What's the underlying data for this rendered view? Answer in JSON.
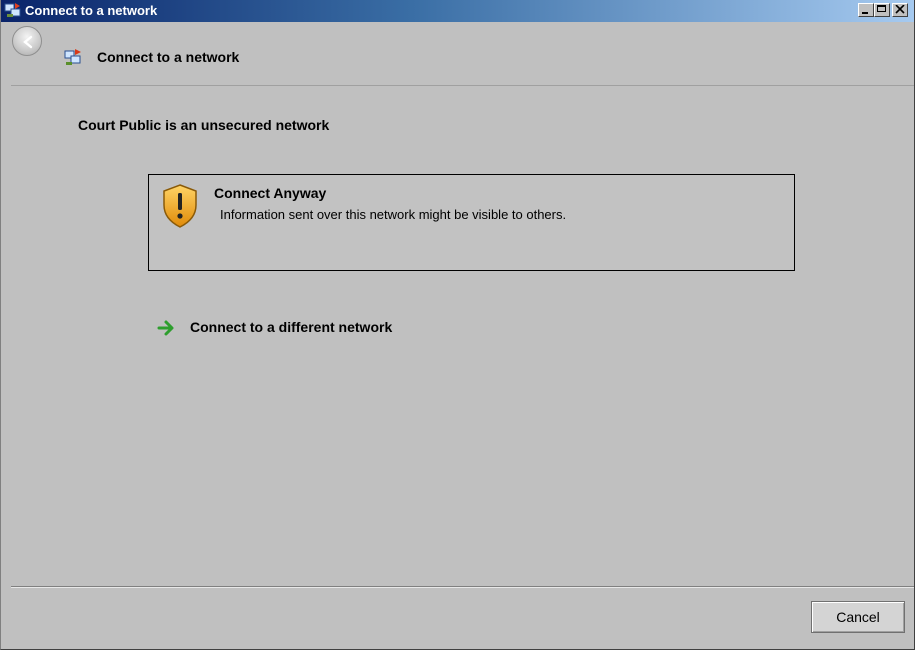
{
  "window": {
    "title": "Connect to a network",
    "icon": "network-connect-icon",
    "controls": {
      "minimize": "minimize-icon",
      "maximize": "maximize-icon",
      "close": "close-icon"
    }
  },
  "nav": {
    "back_icon": "back-arrow-icon",
    "title": "Connect to a network"
  },
  "main": {
    "heading": "Court Public is an unsecured network",
    "connect_anyway": {
      "icon": "warning-shield-icon",
      "title": "Connect Anyway",
      "description": "Information sent over this network might be visible to others."
    },
    "alternative": {
      "icon": "green-arrow-icon",
      "label": "Connect to a different network"
    }
  },
  "footer": {
    "cancel_label": "Cancel"
  },
  "colors": {
    "titlebar_start": "#0a246a",
    "titlebar_end": "#a6caf0",
    "background": "#c0c0c0",
    "arrow_green": "#2e9e2e",
    "shield_orange": "#e89a10"
  }
}
